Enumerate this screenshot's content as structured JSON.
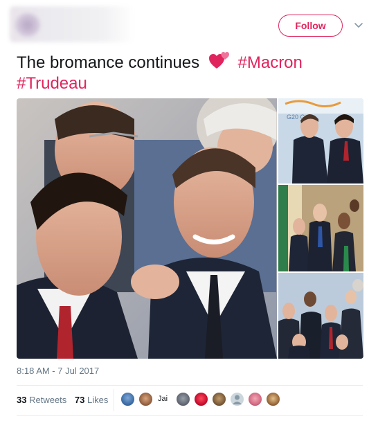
{
  "header": {
    "follow_label": "Follow"
  },
  "tweet": {
    "text": "The bromance continues",
    "hashtags": [
      "#Macron",
      "#Trudeau"
    ],
    "emoji": "two-hearts-icon"
  },
  "media": {
    "main": "photo-main",
    "side": [
      "photo-side-1",
      "photo-side-2",
      "photo-side-3"
    ],
    "photo_caption": "G20 G"
  },
  "meta": {
    "timestamp": "8:18 AM - 7 Jul 2017"
  },
  "stats": {
    "retweets_count": "33",
    "retweets_label": "Retweets",
    "likes_count": "73",
    "likes_label": "Likes"
  },
  "likers": {
    "text_avatar": "Jai"
  },
  "colors": {
    "accent": "#e0245e",
    "text": "#14171a",
    "secondary": "#657786",
    "divider": "#e6ecf0"
  }
}
